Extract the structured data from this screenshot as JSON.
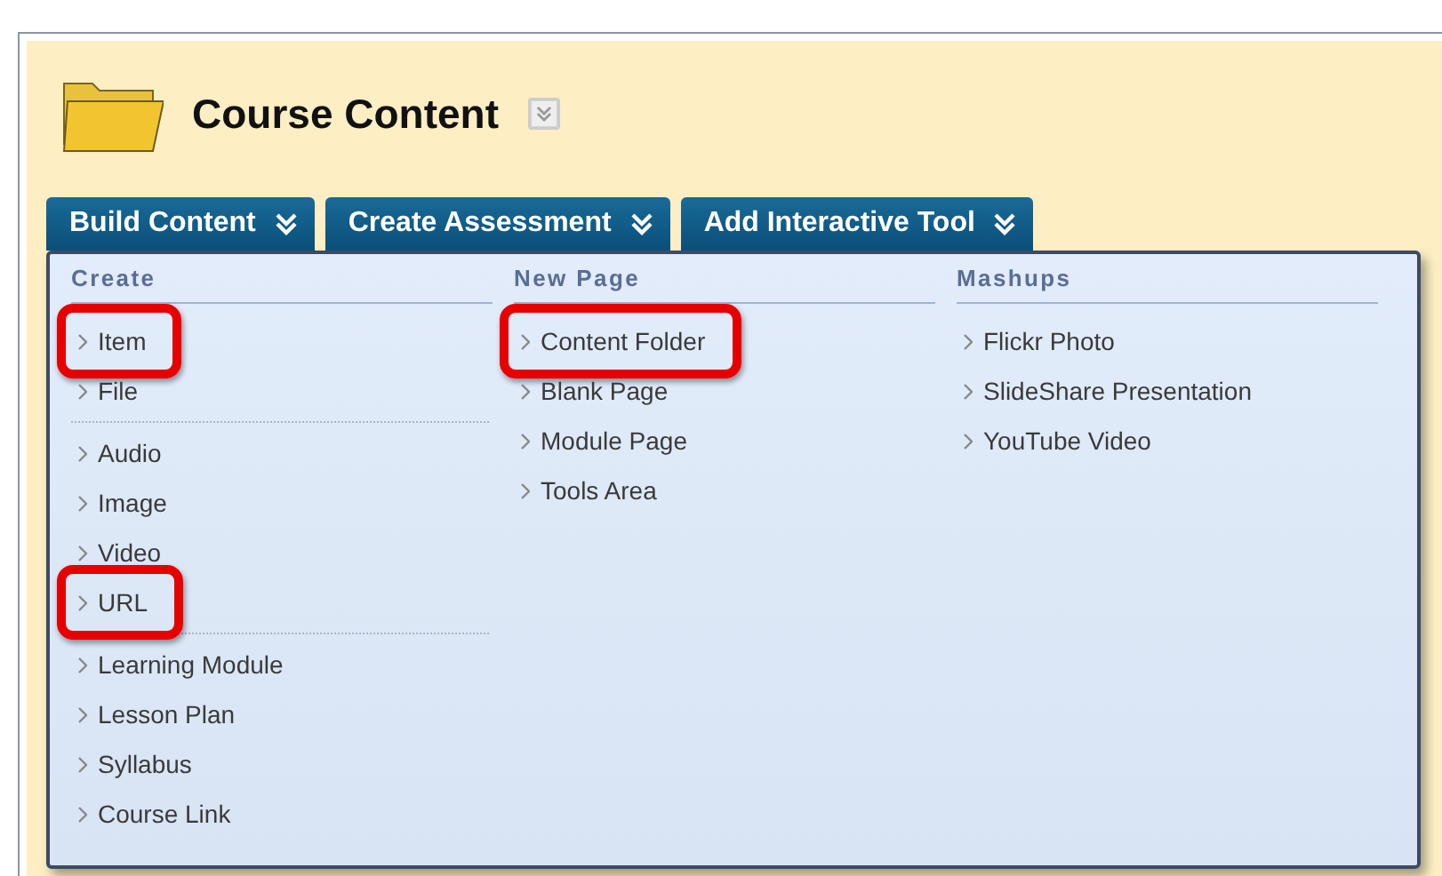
{
  "page": {
    "title": "Course Content"
  },
  "tabs": [
    {
      "label": "Build Content"
    },
    {
      "label": "Create Assessment"
    },
    {
      "label": "Add Interactive Tool"
    }
  ],
  "menu": {
    "columns": [
      {
        "heading": "Create",
        "groups": [
          [
            {
              "label": "Item",
              "highlighted": true
            },
            {
              "label": "File",
              "highlighted": false
            }
          ],
          [
            {
              "label": "Audio",
              "highlighted": false
            },
            {
              "label": "Image",
              "highlighted": false
            },
            {
              "label": "Video",
              "highlighted": false
            },
            {
              "label": "URL",
              "highlighted": true
            }
          ],
          [
            {
              "label": "Learning Module",
              "highlighted": false
            },
            {
              "label": "Lesson Plan",
              "highlighted": false
            },
            {
              "label": "Syllabus",
              "highlighted": false
            },
            {
              "label": "Course Link",
              "highlighted": false
            }
          ]
        ]
      },
      {
        "heading": "New Page",
        "groups": [
          [
            {
              "label": "Content Folder",
              "highlighted": true
            },
            {
              "label": "Blank Page",
              "highlighted": false
            },
            {
              "label": "Module Page",
              "highlighted": false
            },
            {
              "label": "Tools Area",
              "highlighted": false
            }
          ]
        ]
      },
      {
        "heading": "Mashups",
        "groups": [
          [
            {
              "label": "Flickr Photo",
              "highlighted": false
            },
            {
              "label": "SlideShare Presentation",
              "highlighted": false
            },
            {
              "label": "YouTube Video",
              "highlighted": false
            }
          ]
        ]
      }
    ]
  }
}
